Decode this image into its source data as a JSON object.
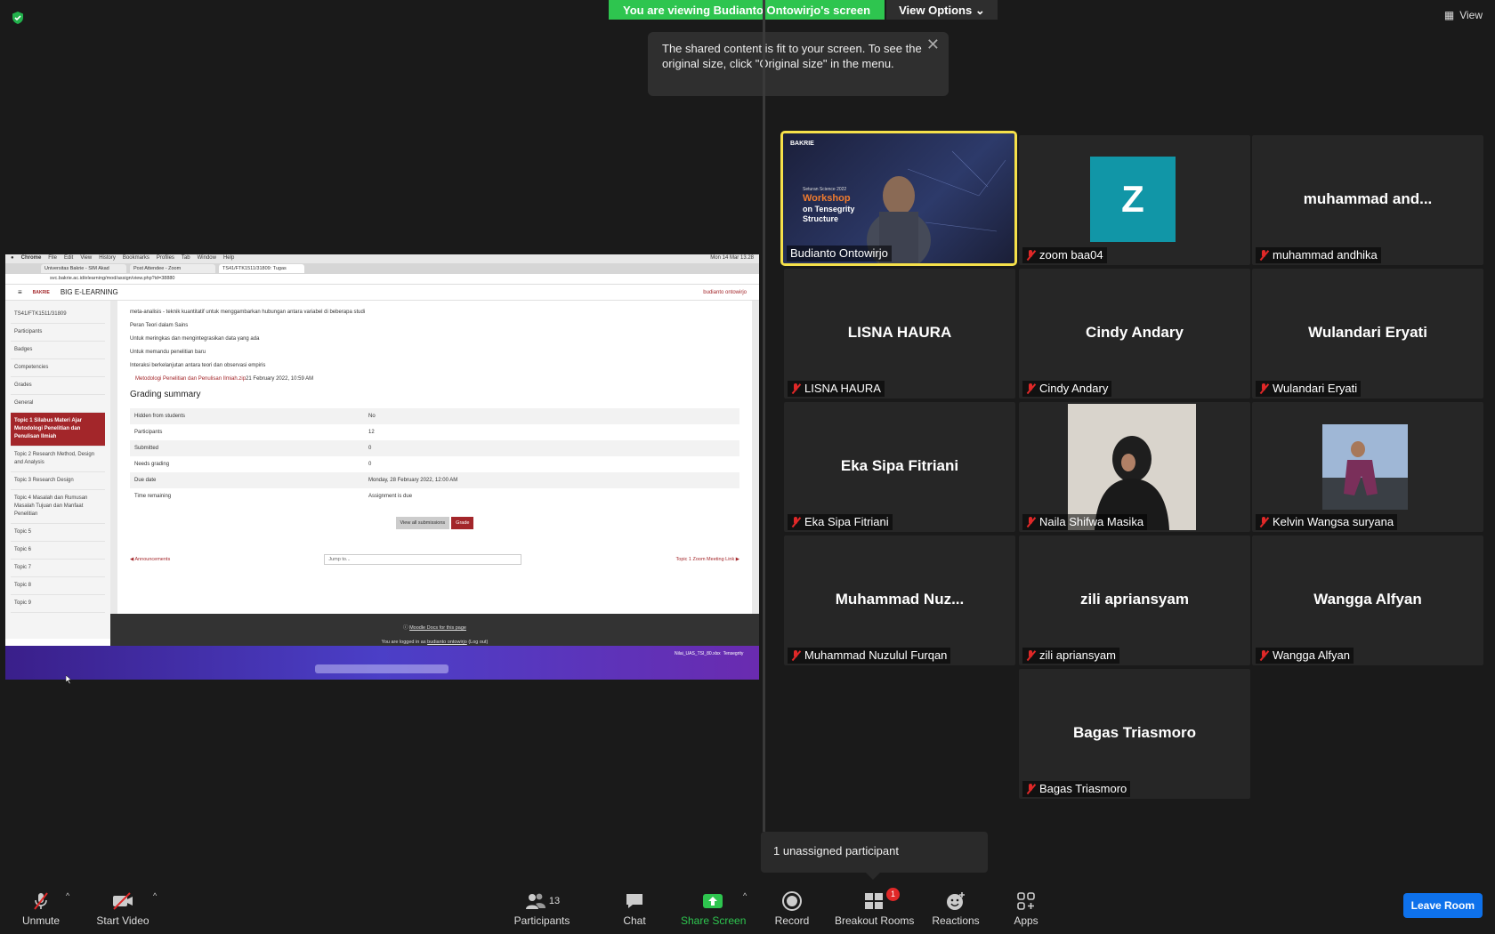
{
  "banner": {
    "viewing": "You are viewing Budianto Ontowirjo's screen",
    "view_options": "View Options"
  },
  "view_button": "View",
  "tooltip": {
    "text": "The shared content is fit to your screen. To see the original size, click \"Original size\" in the menu."
  },
  "shared_screen": {
    "menubar": [
      "Chrome",
      "File",
      "Edit",
      "View",
      "History",
      "Bookmarks",
      "Profiles",
      "Tab",
      "Window",
      "Help"
    ],
    "clock": "Mon 14 Mar 13.28",
    "tabs": [
      "Universitas Bakrie - SIM Akad",
      "Post Attendee - Zoom",
      "TS41/FTK1511/31809: Tugas"
    ],
    "url": "svc.bakrie.ac.id/elearning/mod/assign/view.php?id=38880",
    "site_name": "BIG E-LEARNING",
    "logo": "BAKRIE",
    "user": "budianto ontowirjo",
    "sidebar": [
      "TS41/FTK1511/31809",
      "Participants",
      "Badges",
      "Competencies",
      "Grades",
      "General",
      "Topic 1 Silabus Materi Ajar Metodologi Penelitian dan Penulisan Ilmiah",
      "Topic 2 Research Method, Design and Analysis",
      "Topic 3 Research Design",
      "Topic 4 Masalah dan Rumusan Masalah Tujuan dan Manfaat Penelitian",
      "Topic 5",
      "Topic 6",
      "Topic 7",
      "Topic 8",
      "Topic 9"
    ],
    "lines": [
      "meta-analisis - teknik kuantitatif untuk menggambarkan hubungan antara variabel di beberapa studi",
      "Peran Teori dalam Sains",
      "Untuk meringkas dan mengintegrasikan data yang ada",
      "Untuk memandu penelitian baru",
      "Interaksi berkelanjutan antara teori dan observasi empiris"
    ],
    "file_link": "Metodologi Penelitian dan Penulisan Ilmiah.zip",
    "file_date": "21 February 2022, 10:59 AM",
    "grading_title": "Grading summary",
    "grading_rows": [
      {
        "k": "Hidden from students",
        "v": "No"
      },
      {
        "k": "Participants",
        "v": "12"
      },
      {
        "k": "Submitted",
        "v": "0"
      },
      {
        "k": "Needs grading",
        "v": "0"
      },
      {
        "k": "Due date",
        "v": "Monday, 28 February 2022, 12:00 AM"
      },
      {
        "k": "Time remaining",
        "v": "Assignment is due"
      }
    ],
    "view_all": "View all submissions",
    "grade": "Grade",
    "prev_link": "◀ Announcements",
    "jump_to": "Jump to...",
    "next_link": "Topic 1 Zoom Meeting Link ▶",
    "footer_docs": "Moodle Docs for this page",
    "footer_logged": "You are logged in as",
    "footer_user": "budianto ontowirjo",
    "footer_logout": "(Log out)",
    "desktop_files": [
      "Nilai_UAS_TSI_80.xlsx",
      "Tensegrity"
    ]
  },
  "participants": [
    {
      "label": "Budianto Ontowirjo",
      "muted": false
    },
    {
      "label": "zoom baa04",
      "avatar": "Z",
      "muted": true
    },
    {
      "label": "muhammad andhika",
      "center": "muhammad  and...",
      "muted": true
    },
    {
      "label": "LISNA HAURA",
      "center": "LISNA HAURA",
      "muted": true
    },
    {
      "label": "Cindy Andary",
      "center": "Cindy Andary",
      "muted": true
    },
    {
      "label": "Wulandari Eryati",
      "center": "Wulandari Eryati",
      "muted": true
    },
    {
      "label": "Eka Sipa Fitriani",
      "center": "Eka Sipa Fitriani",
      "muted": true
    },
    {
      "label": "Naila Shifwa Masika",
      "muted": true
    },
    {
      "label": "Kelvin Wangsa suryana",
      "muted": true
    },
    {
      "label": "Muhammad Nuzulul Furqan",
      "center": "Muhammad  Nuz...",
      "muted": true
    },
    {
      "label": "zili apriansyam",
      "center": "zili apriansyam",
      "muted": true
    },
    {
      "label": "Wangga Alfyan",
      "center": "Wangga Alfyan",
      "muted": true
    },
    {
      "label": "Bagas Triasmoro",
      "center": "Bagas Triasmoro",
      "muted": true
    }
  ],
  "workshop_slide": {
    "event": "Seturan Science 2022",
    "title1": "Workshop",
    "title2": "on Tensegrity",
    "title3": "Structure",
    "logo": "BAKRIE"
  },
  "unassigned": "1 unassigned participant",
  "toolbar": {
    "unmute": "Unmute",
    "start_video": "Start Video",
    "participants": "Participants",
    "participants_count": "13",
    "chat": "Chat",
    "share_screen": "Share Screen",
    "record": "Record",
    "breakout": "Breakout Rooms",
    "breakout_badge": "1",
    "reactions": "Reactions",
    "apps": "Apps",
    "leave": "Leave Room"
  },
  "colors": {
    "banner_green": "#2ec54f",
    "speaker_border": "#f5e04a",
    "lms_red": "#a3262a",
    "leave_blue": "#0e71eb",
    "mute_red": "#e02828"
  }
}
